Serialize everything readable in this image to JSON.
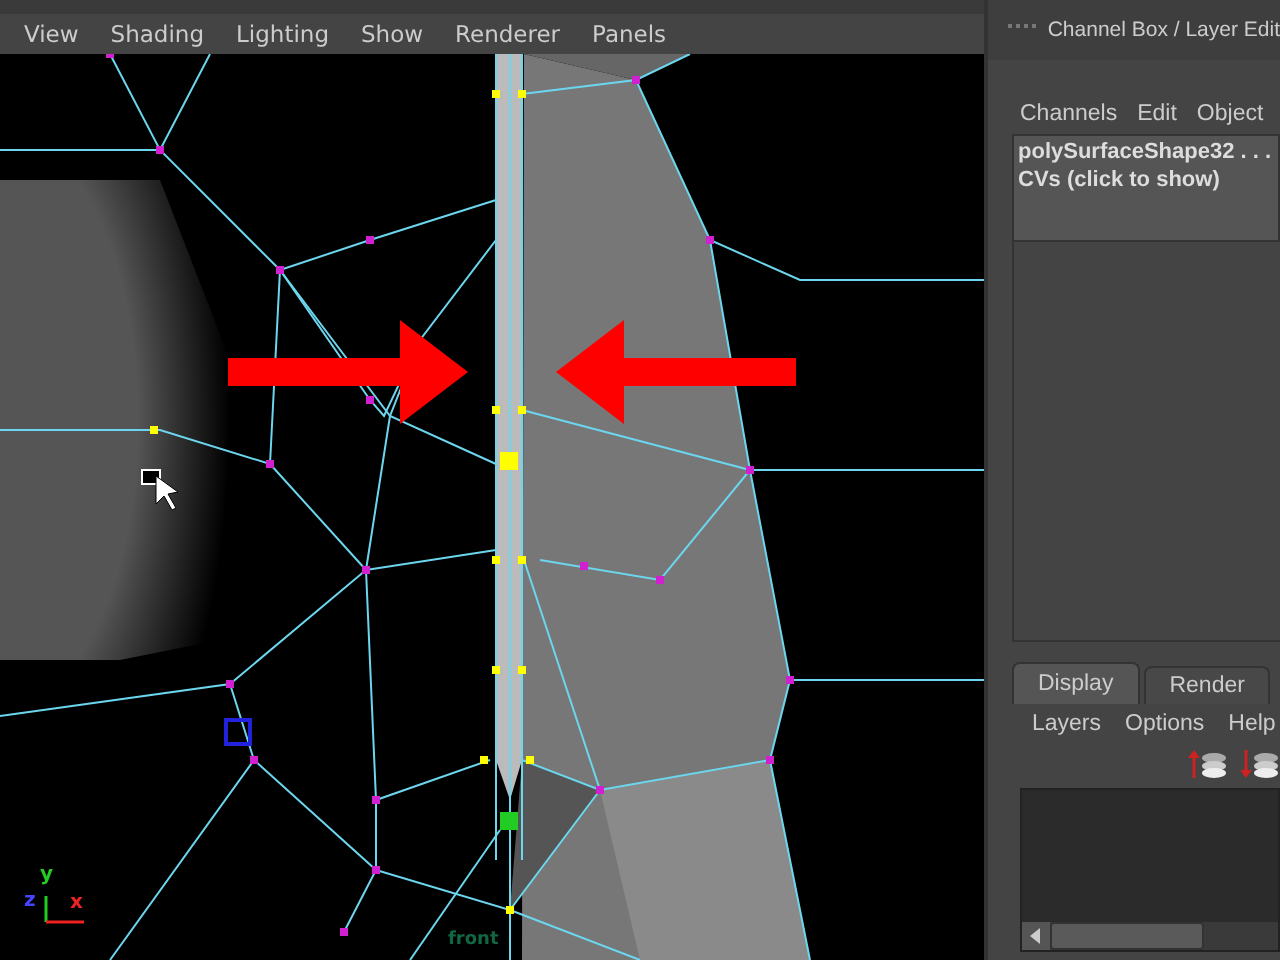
{
  "viewport": {
    "menu": [
      "View",
      "Shading",
      "Lighting",
      "Show",
      "Renderer",
      "Panels"
    ],
    "camera_label": "front",
    "axis": {
      "y": "y",
      "z": "z",
      "x": "x"
    }
  },
  "channel_box": {
    "title": "Channel Box / Layer Edit",
    "menu": [
      "Channels",
      "Edit",
      "Object"
    ],
    "object_name": "polySurfaceShape32 . . .",
    "cvs": "CVs (click to show)"
  },
  "layer_editor": {
    "tabs": [
      {
        "label": "Display",
        "selected": true
      },
      {
        "label": "Render",
        "selected": false
      }
    ],
    "menu": [
      "Layers",
      "Options",
      "Help"
    ]
  }
}
